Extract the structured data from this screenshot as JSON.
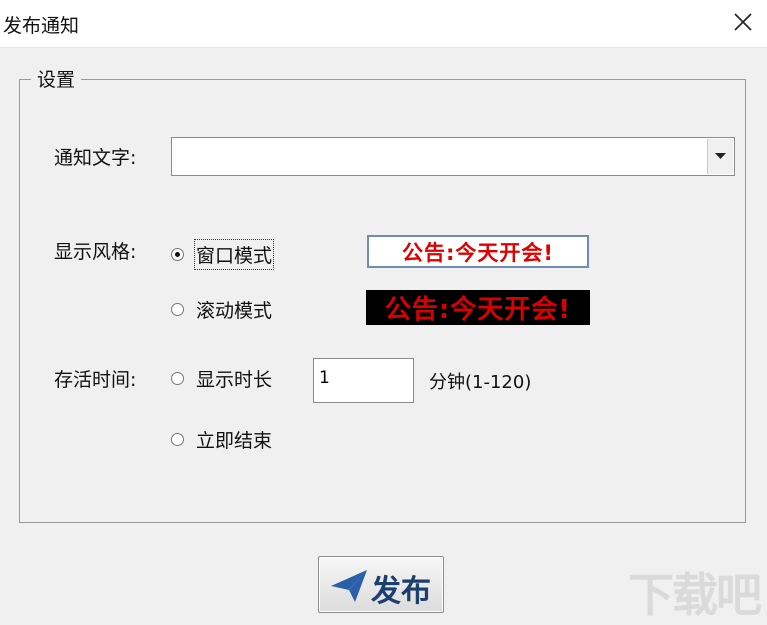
{
  "window": {
    "title": "发布通知",
    "close_icon": "close-icon"
  },
  "settings": {
    "legend": "设置",
    "notice_text": {
      "label": "通知文字:",
      "value": ""
    },
    "display_style": {
      "label": "显示风格:",
      "options": [
        {
          "label": "窗口模式",
          "selected": true
        },
        {
          "label": "滚动模式",
          "selected": false
        }
      ],
      "preview_window_text": "公告:今天开会!",
      "preview_scroll_text": "公告:今天开会!"
    },
    "lifetime": {
      "label": "存活时间:",
      "options": [
        {
          "label": "显示时长",
          "selected": false
        },
        {
          "label": "立即结束",
          "selected": false
        }
      ],
      "duration_value": "1",
      "duration_unit": "分钟(1-120)"
    }
  },
  "actions": {
    "publish_label": "发布"
  },
  "watermark": "下载吧",
  "colors": {
    "preview_red": "#e00000",
    "preview_scroll_bg": "#000000",
    "button_text": "#1c3f6e"
  }
}
